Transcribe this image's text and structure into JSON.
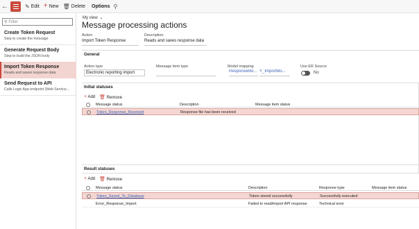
{
  "toolbar": {
    "edit_label": "Edit",
    "new_label": "New",
    "delete_label": "Delete",
    "options_label": "Options"
  },
  "filter": {
    "placeholder": "Filter"
  },
  "nav": [
    {
      "title": "Create Token Request",
      "subtitle": "Step to create the message"
    },
    {
      "title": "Generate Request Body",
      "subtitle": "Step to build the JSON body"
    },
    {
      "title": "Import Token Response",
      "subtitle": "Reads and saves response data"
    },
    {
      "title": "Send Request to API",
      "subtitle": "Calls Logic App endpoint (Web Service..."
    }
  ],
  "page": {
    "view_label": "My view",
    "title": "Message processing actions",
    "action_label": "Action",
    "action_value": "Import Token Response",
    "description_label": "Description",
    "description_value": "Reads and saves response data"
  },
  "general": {
    "header": "General",
    "action_type_label": "Action type",
    "action_type_value": "Electronic reporting import",
    "message_item_type_label": "Message item type",
    "message_item_type_value": "",
    "model_mapping_label": "Model mapping",
    "model_mapping_value_1": "ResponseMo...",
    "model_mapping_value_2": "Y_ImportMo...",
    "use_er_source_label": "Use ER Source",
    "use_er_source_value": "No"
  },
  "initial_statuses": {
    "header": "Initial statuses",
    "add_label": "Add",
    "remove_label": "Remove",
    "columns": [
      "Message status",
      "Description",
      "Message item status"
    ],
    "rows": [
      {
        "status": "Token_Response_Received",
        "description": "Response file has been received",
        "item_status": ""
      }
    ]
  },
  "result_statuses": {
    "header": "Result statuses",
    "add_label": "Add",
    "remove_label": "Remove",
    "columns": [
      "Message status",
      "Description",
      "Response type",
      "Message item status"
    ],
    "rows": [
      {
        "status": "Token_Saved_To_Database",
        "description": "Token stored successfully",
        "response_type": "Successfully executed",
        "item_status": ""
      },
      {
        "status": "Error_Response_Import",
        "description": "Failed to read/import API response",
        "response_type": "Technical error",
        "item_status": ""
      }
    ]
  },
  "colors": {
    "accent": "#c8493b",
    "selected_row": "#f5d6d2",
    "link": "#3b63b6"
  }
}
